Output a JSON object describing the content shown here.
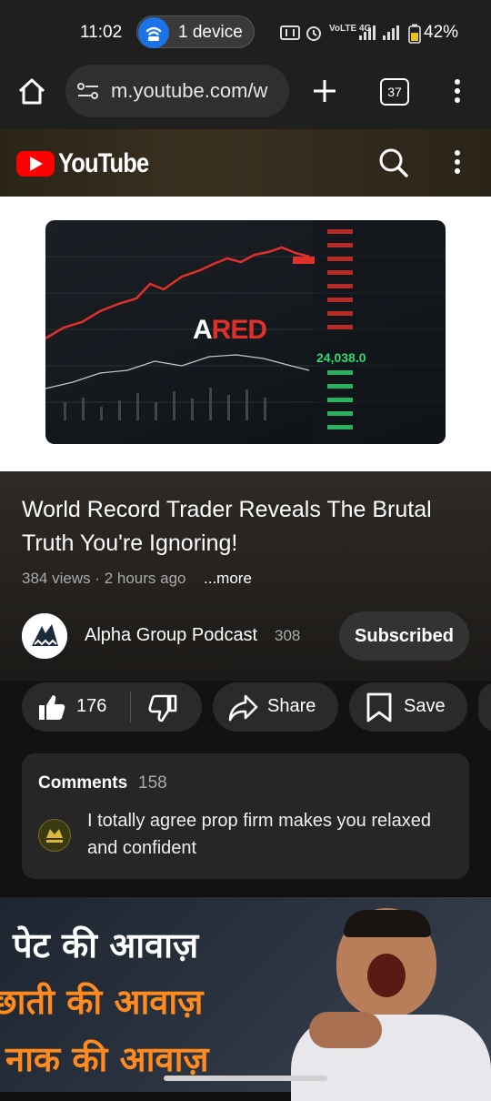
{
  "status_bar": {
    "time": "11:02",
    "device_label": "1 device",
    "network_icons": "VoLTE 4G",
    "battery": "42%"
  },
  "browser": {
    "url": "m.youtube.com/w",
    "tab_count": "37"
  },
  "yt": {
    "wordmark": "YouTube",
    "brand_color": "#ff0000"
  },
  "video": {
    "thumb_text_a": "A",
    "thumb_text_red": "RED",
    "thumb_price": "24,038.0",
    "title": "World Record Trader Reveals The Brutal Truth You're Ignoring!",
    "meta": "384 views · 2 hours ago",
    "more": "...more"
  },
  "channel": {
    "name": "Alpha Group Podcast",
    "subscriber_count": "308",
    "subscribe_state": "Subscribed"
  },
  "actions": {
    "like_count": "176",
    "share_label": "Share",
    "save_label": "Save"
  },
  "comments": {
    "label": "Comments",
    "count": "158",
    "top_comment": "I totally agree prop firm makes you relaxed and confident"
  },
  "next_video": {
    "line1": "पेट की आवाज़",
    "line2": "छाती की आवाज़",
    "line3": "नाक की आवाज़"
  }
}
